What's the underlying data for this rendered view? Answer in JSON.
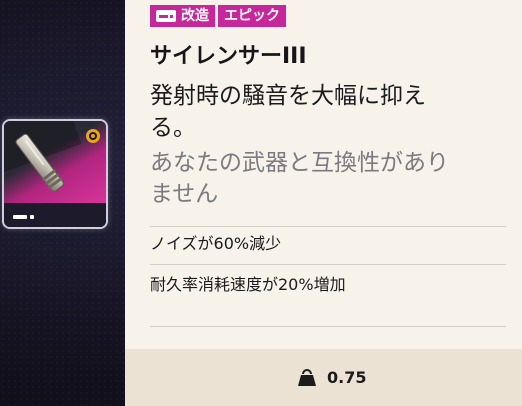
{
  "tooltip": {
    "tags": {
      "mod_label": "改造",
      "rarity_label": "エピック",
      "icon": "mod-attachment-icon"
    },
    "item_name": "サイレンサーIII",
    "description": "発射時の騒音を大幅に抑える。",
    "compatibility": "あなたの武器と互換性がありません",
    "stats": [
      "ノイズが60%減少",
      "耐久率消耗速度が20%増加"
    ],
    "weight": {
      "icon": "weight-icon",
      "value": "0.75"
    }
  },
  "item_slot": {
    "item_icon": "silencer-icon",
    "category_icon": "mod-attachment-icon",
    "badge_icon": "ring-badge-icon"
  },
  "colors": {
    "rarity_epic": "#c6279a",
    "panel_bg": "#f7f3ea",
    "weight_bar_bg": "#ebe2d3",
    "compat_text": "#7c7a80",
    "badge_orange": "#e9a51d"
  }
}
